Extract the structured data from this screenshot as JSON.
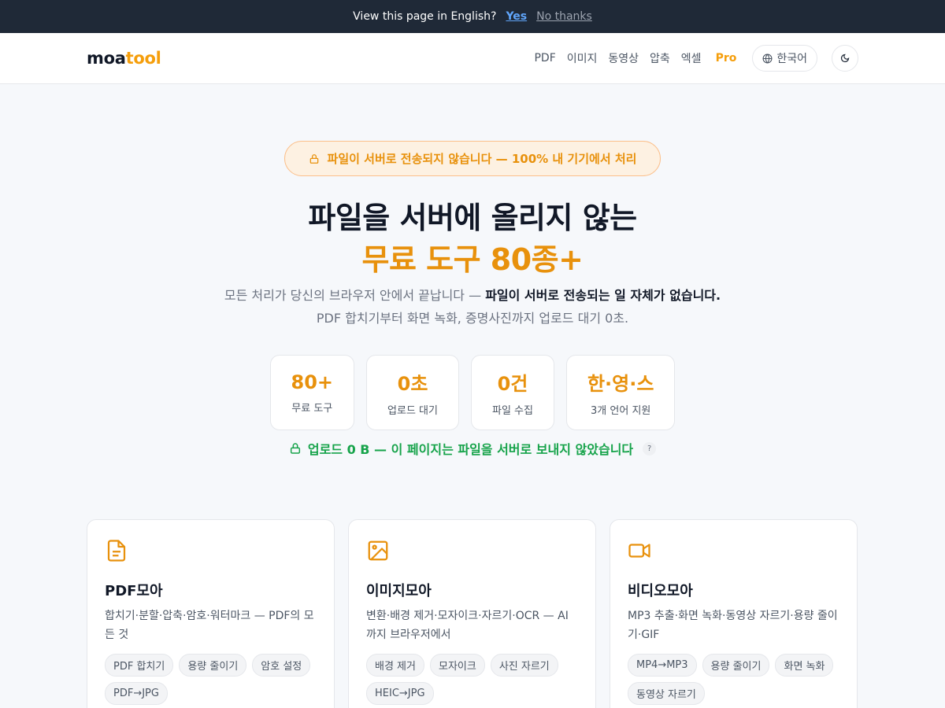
{
  "topbar": {
    "question": "View this page in English?",
    "yes": "Yes",
    "no": "No thanks"
  },
  "nav": {
    "logo_main": "moa",
    "logo_accent": "tool",
    "links": [
      "PDF",
      "이미지",
      "동영상",
      "압축",
      "엑셀"
    ],
    "pro": "Pro",
    "language": "한국어",
    "accent_color": "#f59e0b"
  },
  "hero": {
    "badge": "파일이 서버로 전송되지 않습니다 — 100% 내 기기에서 처리",
    "title_line1": "파일을 서버에 올리지 않는",
    "title_line2": "무료 도구 80종+",
    "subtitle_pre": "모든 처리가 당신의 브라우저 안에서 끝납니다 — ",
    "subtitle_bold": "파일이 서버로 전송되는 일 자체가 없습니다.",
    "subtitle_post": " PDF 합치기부터 화면 녹화, 증명사진까지 업로드 대기 0초."
  },
  "stats": [
    {
      "value": "80+",
      "label": "무료 도구"
    },
    {
      "value": "0초",
      "label": "업로드 대기"
    },
    {
      "value": "0건",
      "label": "파일 수집"
    },
    {
      "value": "한·영·스",
      "label": "3개 언어 지원"
    }
  ],
  "upload_note": {
    "text": "업로드 0 B — 이 페이지는 파일을 서버로 보내지 않았습니다",
    "help": "?"
  },
  "cards": [
    {
      "icon": "file-text-icon",
      "title": "PDF모아",
      "desc": "합치기·분할·압축·암호·워터마크 — PDF의 모든 것",
      "tags": [
        "PDF 합치기",
        "용량 줄이기",
        "암호 설정",
        "PDF→JPG"
      ]
    },
    {
      "icon": "image-icon",
      "title": "이미지모아",
      "desc": "변환·배경 제거·모자이크·자르기·OCR — AI까지 브라우저에서",
      "tags": [
        "배경 제거",
        "모자이크",
        "사진 자르기",
        "HEIC→JPG"
      ]
    },
    {
      "icon": "video-icon",
      "title": "비디오모아",
      "desc": "MP3 추출·화면 녹화·동영상 자르기·용량 줄이기·GIF",
      "tags": [
        "MP4→MP3",
        "용량 줄이기",
        "화면 녹화",
        "동영상 자르기"
      ]
    }
  ]
}
